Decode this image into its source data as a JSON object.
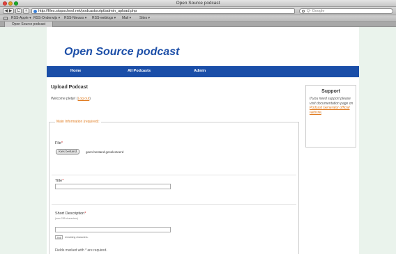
{
  "window": {
    "title": "Open Source podcast"
  },
  "toolbar": {
    "back_label": "◀ ▶",
    "reload_label": "C",
    "add_label": "+",
    "url": "http://files.stopschool.net/podcastscript/admin_upload.php",
    "search_placeholder": "Q- Google"
  },
  "bookmarks": {
    "items": [
      "RSS-Apple ▾",
      "RSS-Onderwijs ▾",
      "RSS-Nieuws ▾",
      "RSS-weblogs ▾",
      "Mail ▾",
      "Sites ▾"
    ]
  },
  "tabs": [
    "Open Source podcast"
  ],
  "site": {
    "title": "Open Source podcast"
  },
  "nav": {
    "home": "Home",
    "all_podcasts": "All Podcasts",
    "admin": "Admin"
  },
  "main": {
    "title": "Upload Podcast",
    "welcome_prefix": "Welcome pletje! (",
    "logout_label": "Log out",
    "welcome_suffix": ")"
  },
  "support": {
    "title": "Support",
    "text": "If you need support please visit documentation page on",
    "link_label": "Podcast Generator official website",
    "text_end": "."
  },
  "form": {
    "legend": "Main Information (required):",
    "file_label": "File",
    "file_button": "Kies bestand",
    "file_status": "geen bestand geselecteerd",
    "title_label": "Title",
    "short_desc_label": "Short Description",
    "short_desc_hint": "(max 255 characters)",
    "counter_value": "255",
    "counter_label": "remaining characters.",
    "required_note": "Fields marked with * are required.",
    "required_mark": "*"
  },
  "colors": {
    "brand_blue": "#1a4ea8",
    "accent_orange": "#e07b1f",
    "page_background": "#eaf3ec"
  }
}
